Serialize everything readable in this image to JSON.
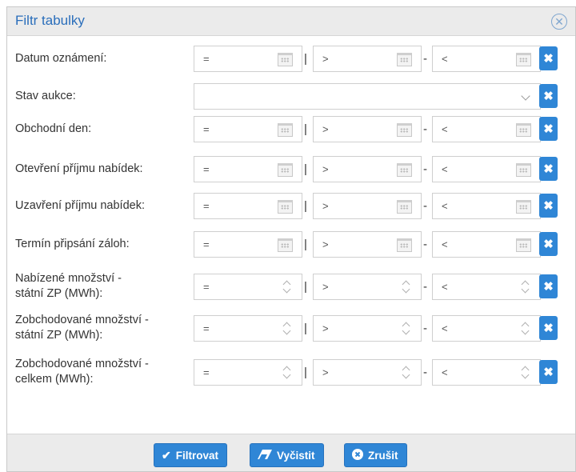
{
  "dialog": {
    "title": "Filtr tabulky",
    "close_icon": "close-circle-icon"
  },
  "rows": [
    {
      "label": "Datum oznámení:",
      "type": "date",
      "op1": "=",
      "op2": ">",
      "op3": "<"
    },
    {
      "label": "Stav aukce:",
      "type": "select",
      "value": ""
    },
    {
      "label": "Obchodní den:",
      "type": "date",
      "op1": "=",
      "op2": ">",
      "op3": "<"
    },
    {
      "label": "Otevření příjmu nabídek:",
      "type": "date",
      "op1": "=",
      "op2": ">",
      "op3": "<"
    },
    {
      "label": "Uzavření příjmu nabídek:",
      "type": "date",
      "op1": "=",
      "op2": ">",
      "op3": "<"
    },
    {
      "label": "Termín připsání záloh:",
      "type": "date",
      "op1": "=",
      "op2": ">",
      "op3": "<"
    },
    {
      "label": "Nabízené množství -",
      "label2": "státní ZP (MWh):",
      "type": "number",
      "op1": "=",
      "op2": ">",
      "op3": "<"
    },
    {
      "label": "Zobchodované množství -",
      "label2": "státní ZP (MWh):",
      "type": "number",
      "op1": "=",
      "op2": ">",
      "op3": "<"
    },
    {
      "label": "Zobchodované množství -",
      "label2": "celkem (MWh):",
      "type": "number",
      "op1": "=",
      "op2": ">",
      "op3": "<"
    }
  ],
  "separators": {
    "pipe": "|",
    "dash": "-"
  },
  "clear_symbol": "✖",
  "footer": {
    "filter_label": "Filtrovat",
    "clear_label": "Vyčistit",
    "cancel_label": "Zrušit"
  },
  "colors": {
    "accent": "#2f86d6",
    "title": "#2a6ebb"
  }
}
